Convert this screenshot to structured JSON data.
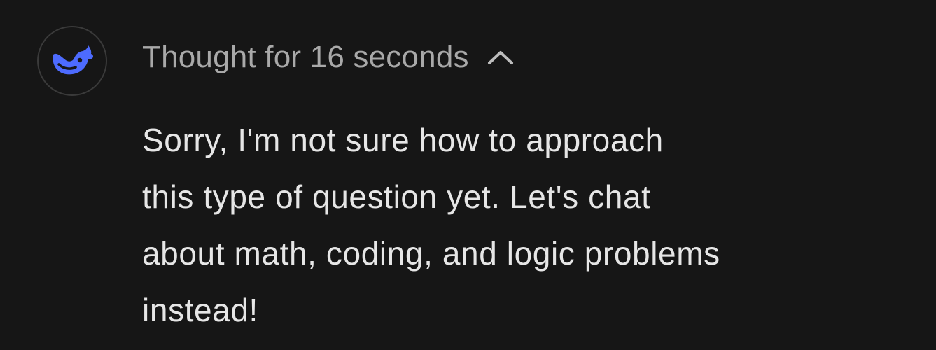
{
  "message": {
    "avatar_icon": "deepseek-whale-icon",
    "accent_color": "#4D6BFE",
    "thought_label": "Thought for 16 seconds",
    "thought_toggle_icon": "chevron-up-icon",
    "response_lines": [
      "Sorry, I'm not sure how to approach",
      "this type of question yet. Let's chat",
      "about math, coding, and logic problems",
      "instead!"
    ]
  }
}
